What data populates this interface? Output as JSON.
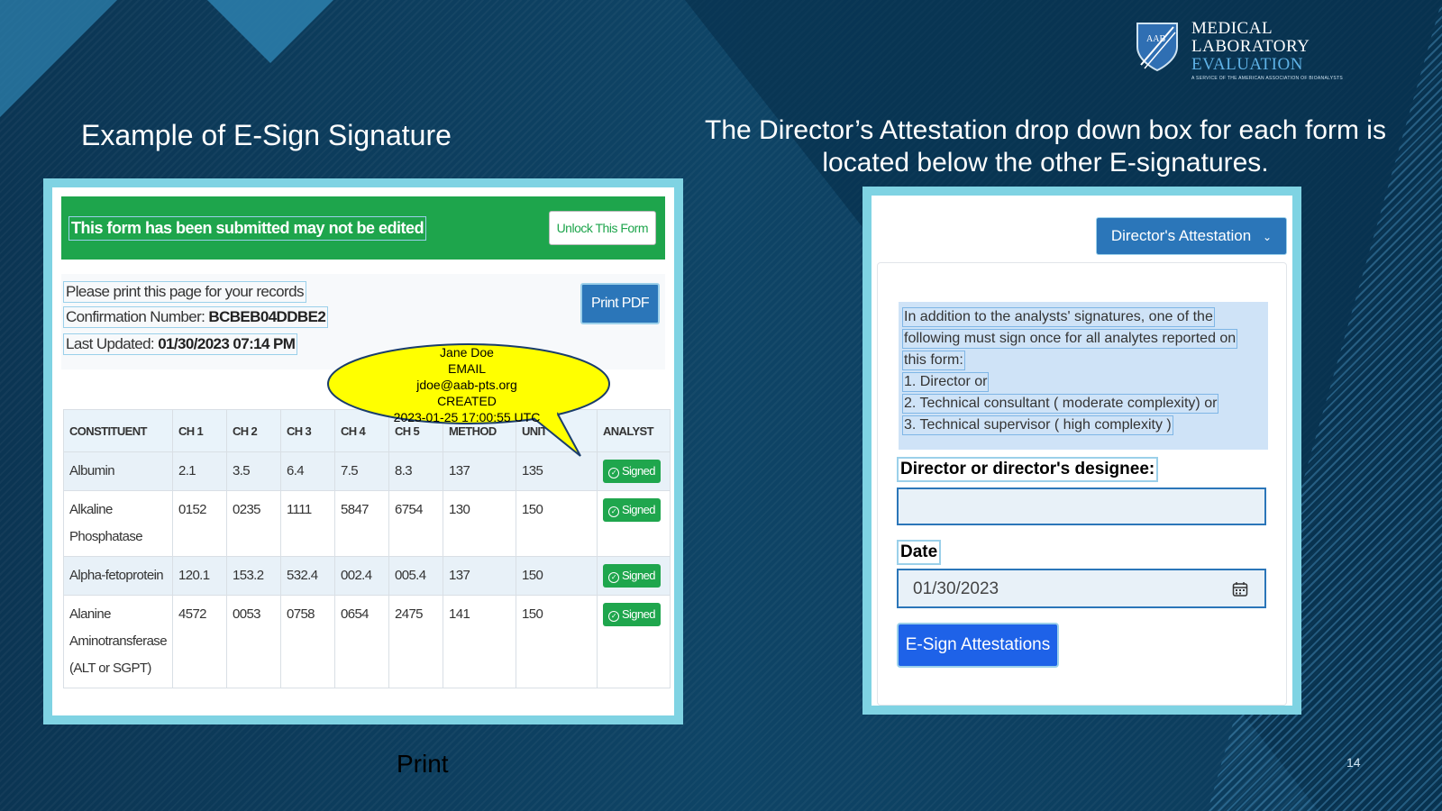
{
  "logo": {
    "line1": "MEDICAL",
    "line2": "LABORATORY",
    "line3": "EVALUATION",
    "tagline": "A SERVICE OF THE AMERICAN ASSOCIATION OF BIOANALYSTS",
    "shield_letters": "AAB"
  },
  "titles": {
    "left": "Example  of E-Sign Signature",
    "right": "The Director’s Attestation drop down box for each form is located below the other E-signatures."
  },
  "form": {
    "banner_text": "This form has been submitted may not be edited",
    "unlock_label": "Unlock This Form",
    "print_notice": "Please print this page for your records",
    "confirmation_label": "Confirmation Number: ",
    "confirmation_value": "BCBEB04DDBE2",
    "updated_label": "Last Updated: ",
    "updated_value": "01/30/2023 07:14 PM",
    "print_pdf_label": "Print PDF",
    "table": {
      "headers": [
        "CONSTITUENT",
        "CH 1",
        "CH 2",
        "CH 3",
        "CH 4",
        "CH 5",
        "METHOD",
        "UNIT",
        "ANALYST"
      ],
      "rows": [
        {
          "name": "Albumin",
          "c1": "2.1",
          "c2": "3.5",
          "c3": "6.4",
          "c4": "7.5",
          "c5": "8.3",
          "method": "137",
          "unit": "135",
          "status": "Signed"
        },
        {
          "name": "Alkaline Phosphatase",
          "c1": "0152",
          "c2": "0235",
          "c3": "1111",
          "c4": "5847",
          "c5": "6754",
          "method": "130",
          "unit": "150",
          "status": "Signed"
        },
        {
          "name": "Alpha-fetoprotein",
          "c1": "120.1",
          "c2": "153.2",
          "c3": "532.4",
          "c4": "002.4",
          "c5": "005.4",
          "method": "137",
          "unit": "150",
          "status": "Signed"
        },
        {
          "name": "Alanine Aminotransferase (ALT or SGPT)",
          "c1": "4572",
          "c2": "0053",
          "c3": "0758",
          "c4": "0654",
          "c5": "2475",
          "method": "141",
          "unit": "150",
          "status": "Signed"
        }
      ]
    },
    "callout": {
      "name": "Jane Doe",
      "email_label": "EMAIL",
      "email": "jdoe@aab-pts.org",
      "created_label": "CREATED",
      "created": "2023-01-25  17:00:55 UTC"
    }
  },
  "attestation": {
    "dropdown_label": "Director's Attestation",
    "info_lines": [
      "In addition to the analysts' signatures, one of the",
      "following must sign once for all analytes reported on",
      "this form:",
      "1. Director or",
      "2. Technical consultant ( moderate complexity) or",
      "3. Technical supervisor ( high complexity )"
    ],
    "designee_label": "Director or director's designee:",
    "designee_value": "",
    "date_label": "Date",
    "date_value": "01/30/2023",
    "esign_label": "E-Sign Attestations"
  },
  "footer": {
    "print_label": "Print",
    "slide_number": "14"
  }
}
